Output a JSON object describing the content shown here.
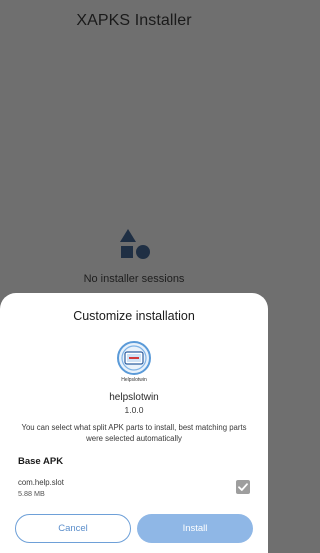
{
  "app": {
    "title": "XAPKS Installer",
    "empty_state_text": "No installer sessions"
  },
  "dialog": {
    "title": "Customize installation",
    "app_logo_text": "Helpslotwin",
    "app_name": "helpslotwin",
    "app_version": "1.0.0",
    "description": "You can select what split APK parts to install, best matching parts were selected automatically",
    "section_title": "Base APK",
    "splits": [
      {
        "name": "com.help.slot",
        "size": "5.88 MB",
        "checked": true
      }
    ],
    "cancel_label": "Cancel",
    "install_label": "Install"
  },
  "colors": {
    "scrim_background": "#6f6f6f",
    "accent": "#5b8ecb",
    "install_button": "#8fb7e6",
    "checkbox_disabled": "#9e9e9e"
  },
  "icons": {
    "empty_state": "shapes-icon",
    "checkbox": "checkmark-icon"
  }
}
